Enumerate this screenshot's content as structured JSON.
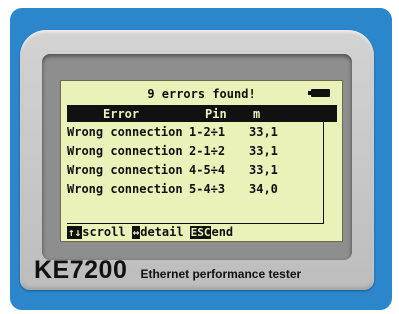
{
  "screen": {
    "title": "9 errors found!",
    "battery_icon": "battery-icon",
    "table": {
      "headers": [
        "Error",
        "Pin",
        "m"
      ],
      "rows": [
        {
          "error": "Wrong connection",
          "pin": "1-2÷1",
          "m": "33,1"
        },
        {
          "error": "Wrong connection",
          "pin": "2-1÷2",
          "m": "33,1"
        },
        {
          "error": "Wrong connection",
          "pin": "4-5÷4",
          "m": "33,1"
        },
        {
          "error": "Wrong connection",
          "pin": "5-4÷3",
          "m": "34,0"
        }
      ]
    },
    "footer": [
      {
        "key": "↑↓",
        "label": "scroll",
        "icon": "up-down-arrows-icon"
      },
      {
        "key": "↔",
        "label": "detail",
        "icon": "left-right-arrows-icon"
      },
      {
        "key": "ESC",
        "label": "end",
        "icon": "esc-key-icon"
      }
    ]
  },
  "device": {
    "model": "KE7200",
    "description": "Ethernet performance tester"
  },
  "colors": {
    "frame_blue": "#2c86cc",
    "case_gray": "#c7c7c7",
    "lcd_background": "#eaf2ba",
    "lcd_ink": "#111111"
  }
}
